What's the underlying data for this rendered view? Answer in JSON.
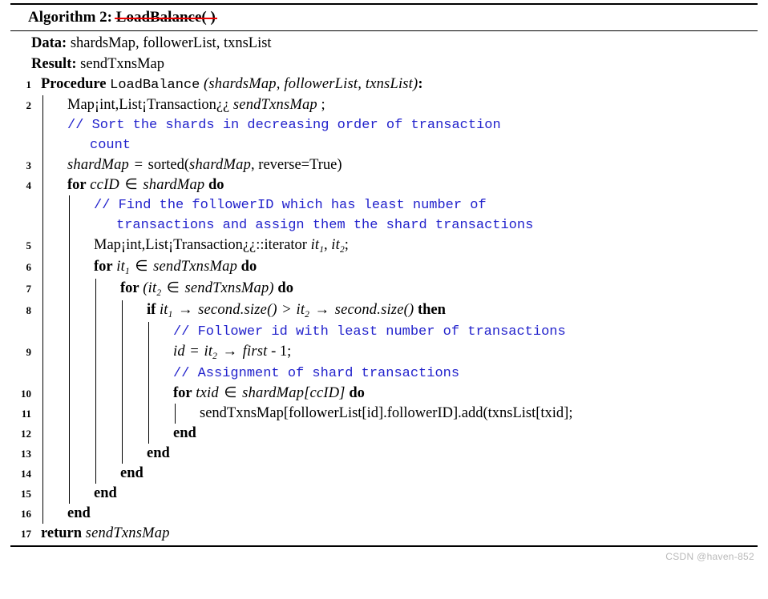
{
  "caption": {
    "label": "Algorithm 2:",
    "name": "LoadBalance( )"
  },
  "spec": {
    "data_label": "Data:",
    "data_value": "shardsMap, followerList, txnsList",
    "result_label": "Result:",
    "result_value": "sendTxnsMap"
  },
  "colors": {
    "comment": "#2222cc",
    "strikethrough": "#ee0000",
    "watermark": "#b9b9b9",
    "text": "#000000"
  },
  "lines": {
    "n1": "1",
    "n2": "2",
    "n3": "3",
    "n4": "4",
    "n5": "5",
    "n6": "6",
    "n7": "7",
    "n8": "8",
    "n9": "9",
    "n10": "10",
    "n11": "11",
    "n12": "12",
    "n13": "13",
    "n14": "14",
    "n15": "15",
    "n16": "16",
    "n17": "17"
  },
  "code": {
    "l1": {
      "kw": "Procedure",
      "name": "LoadBalance",
      "args": "(shardsMap, followerList, txnsList)",
      "colon": ":"
    },
    "l2": {
      "type": "Map¡int,List¡Transaction¿¿",
      "var": "sendTxnsMap",
      "term": ";"
    },
    "c1": {
      "text": "// Sort the shards in decreasing order of transaction",
      "cont": "count"
    },
    "l3": {
      "lhs": "shardMap",
      "eq": "=",
      "fn": "sorted(",
      "arg": "shardMap",
      "rest": ", reverse=True)"
    },
    "l4": {
      "kw_for": "for",
      "var": "ccID",
      "in": "∈",
      "iter": "shardMap",
      "kw_do": "do"
    },
    "c2": {
      "text": "// Find the followerID which has least number of",
      "cont": "transactions and assign them the shard transactions"
    },
    "l5": {
      "type": "Map¡int,List¡Transaction¿¿::iterator",
      "it1": "it",
      "sub1": "1",
      "comma": ",",
      "it2": "it",
      "sub2": "2",
      "term": ";"
    },
    "l6": {
      "kw_for": "for",
      "it": "it",
      "sub": "1",
      "in": "∈",
      "iter": "sendTxnsMap",
      "kw_do": "do"
    },
    "l7": {
      "kw_for": "for",
      "open": "(",
      "it": "it",
      "sub": "2",
      "in": "∈",
      "iter": "sendTxnsMap)",
      "kw_do": "do"
    },
    "l8": {
      "kw_if": "if",
      "lit": "it",
      "lsub": "1",
      "arrow1": "→",
      "lcall": "second.size()",
      "gt": ">",
      "rit": "it",
      "rsub": "2",
      "arrow2": "→",
      "rcall": "second.size()",
      "kw_then": "then"
    },
    "c3": {
      "text": "// Follower id with least number of transactions"
    },
    "l9": {
      "lhs": "id",
      "eq": "=",
      "it": "it",
      "sub": "2",
      "arrow": "→",
      "field": "first",
      "rest": "- 1;"
    },
    "c4": {
      "text": "// Assignment of shard transactions"
    },
    "l10": {
      "kw_for": "for",
      "var": "txid",
      "in": "∈",
      "iter": "shardMap[ccID]",
      "kw_do": "do"
    },
    "l11": {
      "stmt": "sendTxnsMap[followerList[id].followerID].add(txnsList[txid];"
    },
    "l12": {
      "kw": "end"
    },
    "l13": {
      "kw": "end"
    },
    "l14": {
      "kw": "end"
    },
    "l15": {
      "kw": "end"
    },
    "l16": {
      "kw": "end"
    },
    "l17": {
      "kw": "return",
      "var": "sendTxnsMap"
    }
  },
  "watermark": {
    "text": "CSDN @haven-852"
  }
}
